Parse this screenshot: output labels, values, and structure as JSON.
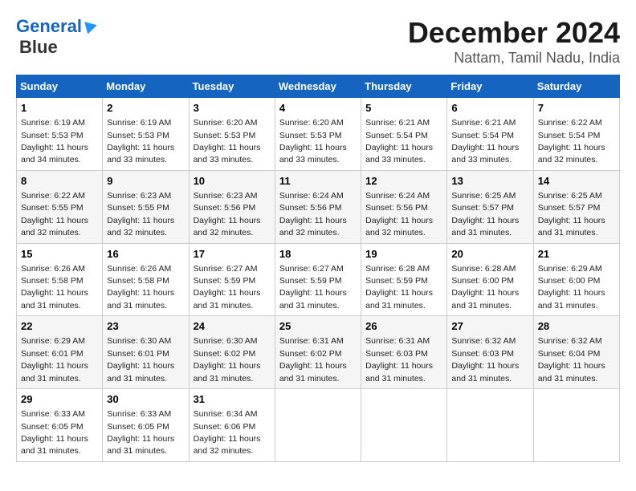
{
  "logo": {
    "line1": "General",
    "line2": "Blue"
  },
  "title": "December 2024",
  "subtitle": "Nattam, Tamil Nadu, India",
  "days_of_week": [
    "Sunday",
    "Monday",
    "Tuesday",
    "Wednesday",
    "Thursday",
    "Friday",
    "Saturday"
  ],
  "weeks": [
    [
      {
        "day": "1",
        "sunrise": "Sunrise: 6:19 AM",
        "sunset": "Sunset: 5:53 PM",
        "daylight": "Daylight: 11 hours and 34 minutes."
      },
      {
        "day": "2",
        "sunrise": "Sunrise: 6:19 AM",
        "sunset": "Sunset: 5:53 PM",
        "daylight": "Daylight: 11 hours and 33 minutes."
      },
      {
        "day": "3",
        "sunrise": "Sunrise: 6:20 AM",
        "sunset": "Sunset: 5:53 PM",
        "daylight": "Daylight: 11 hours and 33 minutes."
      },
      {
        "day": "4",
        "sunrise": "Sunrise: 6:20 AM",
        "sunset": "Sunset: 5:53 PM",
        "daylight": "Daylight: 11 hours and 33 minutes."
      },
      {
        "day": "5",
        "sunrise": "Sunrise: 6:21 AM",
        "sunset": "Sunset: 5:54 PM",
        "daylight": "Daylight: 11 hours and 33 minutes."
      },
      {
        "day": "6",
        "sunrise": "Sunrise: 6:21 AM",
        "sunset": "Sunset: 5:54 PM",
        "daylight": "Daylight: 11 hours and 33 minutes."
      },
      {
        "day": "7",
        "sunrise": "Sunrise: 6:22 AM",
        "sunset": "Sunset: 5:54 PM",
        "daylight": "Daylight: 11 hours and 32 minutes."
      }
    ],
    [
      {
        "day": "8",
        "sunrise": "Sunrise: 6:22 AM",
        "sunset": "Sunset: 5:55 PM",
        "daylight": "Daylight: 11 hours and 32 minutes."
      },
      {
        "day": "9",
        "sunrise": "Sunrise: 6:23 AM",
        "sunset": "Sunset: 5:55 PM",
        "daylight": "Daylight: 11 hours and 32 minutes."
      },
      {
        "day": "10",
        "sunrise": "Sunrise: 6:23 AM",
        "sunset": "Sunset: 5:56 PM",
        "daylight": "Daylight: 11 hours and 32 minutes."
      },
      {
        "day": "11",
        "sunrise": "Sunrise: 6:24 AM",
        "sunset": "Sunset: 5:56 PM",
        "daylight": "Daylight: 11 hours and 32 minutes."
      },
      {
        "day": "12",
        "sunrise": "Sunrise: 6:24 AM",
        "sunset": "Sunset: 5:56 PM",
        "daylight": "Daylight: 11 hours and 32 minutes."
      },
      {
        "day": "13",
        "sunrise": "Sunrise: 6:25 AM",
        "sunset": "Sunset: 5:57 PM",
        "daylight": "Daylight: 11 hours and 31 minutes."
      },
      {
        "day": "14",
        "sunrise": "Sunrise: 6:25 AM",
        "sunset": "Sunset: 5:57 PM",
        "daylight": "Daylight: 11 hours and 31 minutes."
      }
    ],
    [
      {
        "day": "15",
        "sunrise": "Sunrise: 6:26 AM",
        "sunset": "Sunset: 5:58 PM",
        "daylight": "Daylight: 11 hours and 31 minutes."
      },
      {
        "day": "16",
        "sunrise": "Sunrise: 6:26 AM",
        "sunset": "Sunset: 5:58 PM",
        "daylight": "Daylight: 11 hours and 31 minutes."
      },
      {
        "day": "17",
        "sunrise": "Sunrise: 6:27 AM",
        "sunset": "Sunset: 5:59 PM",
        "daylight": "Daylight: 11 hours and 31 minutes."
      },
      {
        "day": "18",
        "sunrise": "Sunrise: 6:27 AM",
        "sunset": "Sunset: 5:59 PM",
        "daylight": "Daylight: 11 hours and 31 minutes."
      },
      {
        "day": "19",
        "sunrise": "Sunrise: 6:28 AM",
        "sunset": "Sunset: 5:59 PM",
        "daylight": "Daylight: 11 hours and 31 minutes."
      },
      {
        "day": "20",
        "sunrise": "Sunrise: 6:28 AM",
        "sunset": "Sunset: 6:00 PM",
        "daylight": "Daylight: 11 hours and 31 minutes."
      },
      {
        "day": "21",
        "sunrise": "Sunrise: 6:29 AM",
        "sunset": "Sunset: 6:00 PM",
        "daylight": "Daylight: 11 hours and 31 minutes."
      }
    ],
    [
      {
        "day": "22",
        "sunrise": "Sunrise: 6:29 AM",
        "sunset": "Sunset: 6:01 PM",
        "daylight": "Daylight: 11 hours and 31 minutes."
      },
      {
        "day": "23",
        "sunrise": "Sunrise: 6:30 AM",
        "sunset": "Sunset: 6:01 PM",
        "daylight": "Daylight: 11 hours and 31 minutes."
      },
      {
        "day": "24",
        "sunrise": "Sunrise: 6:30 AM",
        "sunset": "Sunset: 6:02 PM",
        "daylight": "Daylight: 11 hours and 31 minutes."
      },
      {
        "day": "25",
        "sunrise": "Sunrise: 6:31 AM",
        "sunset": "Sunset: 6:02 PM",
        "daylight": "Daylight: 11 hours and 31 minutes."
      },
      {
        "day": "26",
        "sunrise": "Sunrise: 6:31 AM",
        "sunset": "Sunset: 6:03 PM",
        "daylight": "Daylight: 11 hours and 31 minutes."
      },
      {
        "day": "27",
        "sunrise": "Sunrise: 6:32 AM",
        "sunset": "Sunset: 6:03 PM",
        "daylight": "Daylight: 11 hours and 31 minutes."
      },
      {
        "day": "28",
        "sunrise": "Sunrise: 6:32 AM",
        "sunset": "Sunset: 6:04 PM",
        "daylight": "Daylight: 11 hours and 31 minutes."
      }
    ],
    [
      {
        "day": "29",
        "sunrise": "Sunrise: 6:33 AM",
        "sunset": "Sunset: 6:05 PM",
        "daylight": "Daylight: 11 hours and 31 minutes."
      },
      {
        "day": "30",
        "sunrise": "Sunrise: 6:33 AM",
        "sunset": "Sunset: 6:05 PM",
        "daylight": "Daylight: 11 hours and 31 minutes."
      },
      {
        "day": "31",
        "sunrise": "Sunrise: 6:34 AM",
        "sunset": "Sunset: 6:06 PM",
        "daylight": "Daylight: 11 hours and 32 minutes."
      },
      null,
      null,
      null,
      null
    ]
  ]
}
